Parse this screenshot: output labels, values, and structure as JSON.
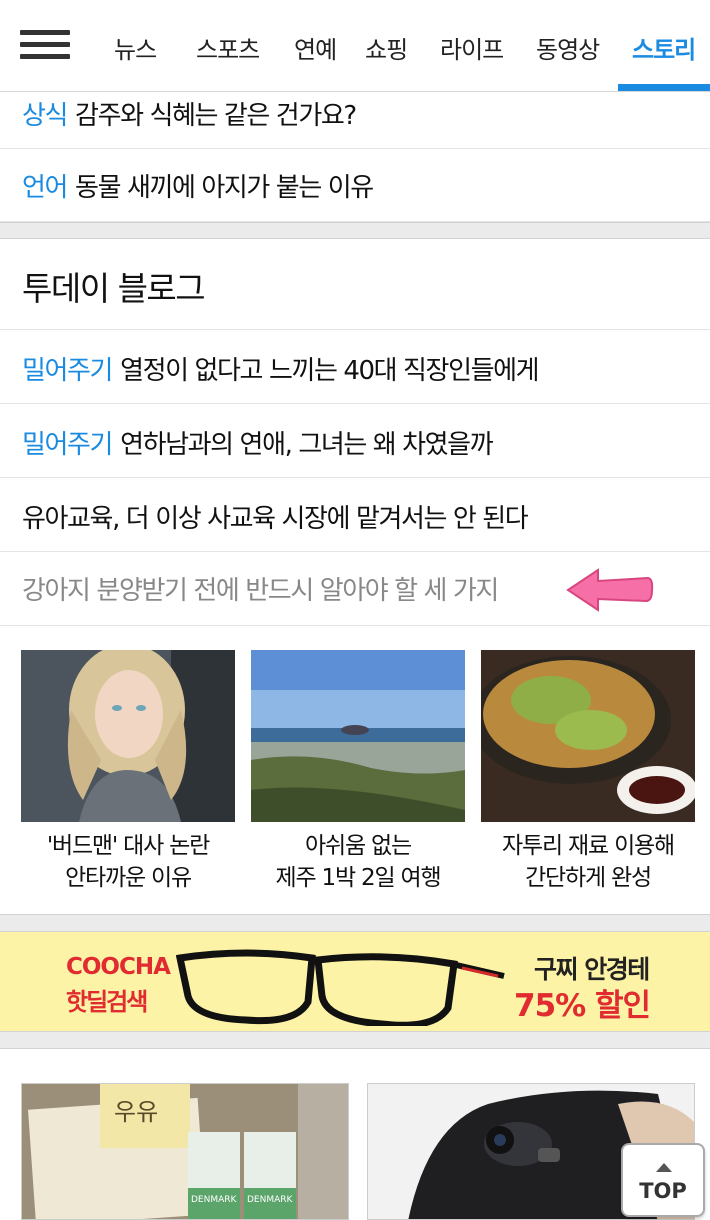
{
  "nav": {
    "tabs": [
      "뉴스",
      "스포츠",
      "연예",
      "쇼핑",
      "라이프",
      "동영상",
      "스토리"
    ],
    "active_tab": "스토리"
  },
  "top_list": [
    {
      "category": "상식",
      "title": "감주와 식혜는 같은 건가요?"
    },
    {
      "category": "언어",
      "title": "동물 새끼에 아지가 붙는 이유"
    }
  ],
  "today_blog": {
    "heading": "투데이 블로그",
    "items": [
      {
        "category": "밀어주기",
        "title": "열정이 없다고 느끼는 40대 직장인들에게"
      },
      {
        "category": "밀어주기",
        "title": "연하남과의 연애, 그녀는 왜 차였을까"
      },
      {
        "category": "",
        "title": "유아교육, 더 이상 사교육 시장에 맡겨서는 안 된다"
      },
      {
        "category": "",
        "title": "강아지 분양받기 전에 반드시 알아야 할 세 가지"
      }
    ],
    "thumbs": [
      {
        "line1": "'버드맨' 대사 논란",
        "line2": "안타까운 이유"
      },
      {
        "line1": "아쉬움 없는",
        "line2": "제주 1박 2일 여행"
      },
      {
        "line1": "자투리 재료 이용해",
        "line2": "간단하게 완성"
      }
    ]
  },
  "ad_banner": {
    "logo_line1": "COOCHA",
    "logo_line2": "핫딜검색",
    "promo_line1": "구찌 안경테",
    "promo_line2": "75% 할인"
  },
  "bottom_thumbs": {
    "milk_text": "우유",
    "brand": "DENMARK"
  },
  "top_button": "TOP",
  "colors": {
    "accent": "#1a8be0",
    "promo": "#e02b30",
    "banner_bg": "#fdf3a6"
  }
}
